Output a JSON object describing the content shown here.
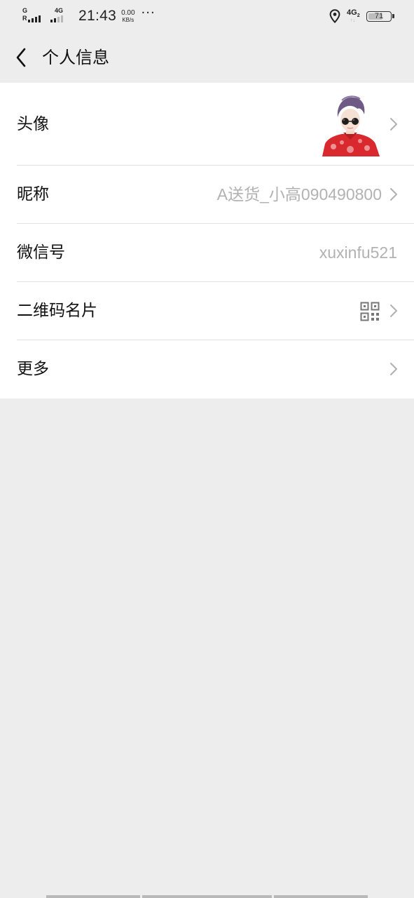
{
  "status_bar": {
    "sim1_type_top": "G",
    "sim1_type_bottom": "R",
    "sim2_type": "4G",
    "time": "21:43",
    "net_speed_value": "0.00",
    "net_speed_unit": "KB/s",
    "more": "···",
    "data_type": "4G",
    "data_sim": "2",
    "battery_level": "71",
    "battery_fraction": 0.71,
    "colors": {
      "text": "#222222",
      "dim": "#b8b8b8"
    }
  },
  "nav": {
    "back_icon": "chevron-left-icon",
    "title": "个人信息"
  },
  "rows": [
    {
      "id": "avatar",
      "label": "头像",
      "value": "",
      "chevron": true
    },
    {
      "id": "nickname",
      "label": "昵称",
      "value": "A送货_小高090490800",
      "chevron": true
    },
    {
      "id": "wechat-id",
      "label": "微信号",
      "value": "xuxinfu521",
      "chevron": false
    },
    {
      "id": "qr-card",
      "label": "二维码名片",
      "value": "",
      "icon": "qr-code-icon",
      "chevron": true
    },
    {
      "id": "more",
      "label": "更多",
      "value": "",
      "chevron": true
    }
  ],
  "colors": {
    "page_background": "#ededed",
    "list_background": "#ffffff",
    "primary_text": "#111111",
    "secondary_text": "#b2b2b2",
    "divider": "#e2e2e2",
    "chevron": "#b0b0b0"
  }
}
